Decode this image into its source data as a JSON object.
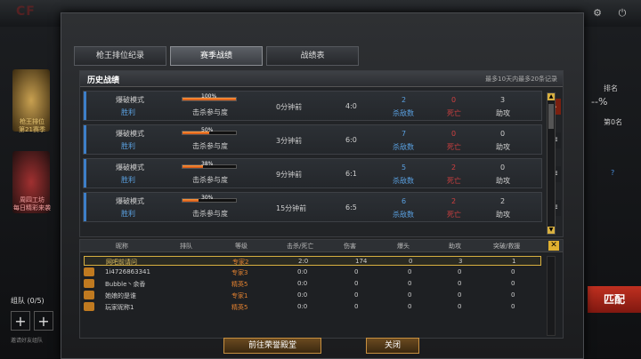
{
  "bg": {
    "left_rank": "枪王排位",
    "left_rank2": "第21赛季",
    "left_event": "周四工坊",
    "left_event2": "每日精彩来袭",
    "squad": "组队 (0/5)",
    "invite_hint": "邀请好友组队",
    "right_rank_label": "排名",
    "right_pct": "--%",
    "right_place": "第0名",
    "match_label": "匹配"
  },
  "tabs": [
    "枪王排位纪录",
    "赛季战绩",
    "战绩表"
  ],
  "panel": {
    "title": "历史战绩",
    "note": "最多10天内最多20条记录"
  },
  "history": [
    {
      "mode": "爆破模式",
      "result": "胜利",
      "pct": 100,
      "pct_text": "100%",
      "metric": "击杀参与度",
      "time": "0分钟前",
      "score": "4:0",
      "kills": "2",
      "kills_lbl": "杀敌数",
      "deaths": "0",
      "deaths_lbl": "死亡",
      "assists": "3",
      "assists_lbl": "助攻"
    },
    {
      "mode": "爆破模式",
      "result": "胜利",
      "pct": 50,
      "pct_text": "50%",
      "metric": "击杀参与度",
      "time": "3分钟前",
      "score": "6:0",
      "kills": "7",
      "kills_lbl": "杀敌数",
      "deaths": "0",
      "deaths_lbl": "死亡",
      "assists": "0",
      "assists_lbl": "助攻"
    },
    {
      "mode": "爆破模式",
      "result": "胜利",
      "pct": 38,
      "pct_text": "38%",
      "metric": "击杀参与度",
      "time": "9分钟前",
      "score": "6:1",
      "kills": "5",
      "kills_lbl": "杀敌数",
      "deaths": "2",
      "deaths_lbl": "死亡",
      "assists": "0",
      "assists_lbl": "助攻"
    },
    {
      "mode": "爆破模式",
      "result": "胜利",
      "pct": 30,
      "pct_text": "30%",
      "metric": "击杀参与度",
      "time": "15分钟前",
      "score": "6:5",
      "kills": "6",
      "kills_lbl": "杀敌数",
      "deaths": "2",
      "deaths_lbl": "死亡",
      "assists": "2",
      "assists_lbl": "助攻"
    }
  ],
  "table": {
    "headers": [
      "昵称",
      "排队",
      "等级",
      "击杀/死亡",
      "伤害",
      "爆头",
      "助攻",
      "突破/救援"
    ],
    "rows": [
      {
        "name": "网吧前请问",
        "rank": "",
        "level": "专家2",
        "kd": "2:0",
        "dmg": "174",
        "hs": "0",
        "ast": "3",
        "brk": "1",
        "me": true
      },
      {
        "name": "1i4726863341",
        "rank": "",
        "level": "专家3",
        "kd": "0:0",
        "dmg": "0",
        "hs": "0",
        "ast": "0",
        "brk": "0",
        "me": false
      },
      {
        "name": "Bubble丶余香",
        "rank": "",
        "level": "精英5",
        "kd": "0:0",
        "dmg": "0",
        "hs": "0",
        "ast": "0",
        "brk": "0",
        "me": false
      },
      {
        "name": "她娘的是谁",
        "rank": "",
        "level": "专家1",
        "kd": "0:0",
        "dmg": "0",
        "hs": "0",
        "ast": "0",
        "brk": "0",
        "me": false
      },
      {
        "name": "玩家昵称1",
        "rank": "",
        "level": "精英5",
        "kd": "0:0",
        "dmg": "0",
        "hs": "0",
        "ast": "0",
        "brk": "0",
        "me": false
      }
    ]
  },
  "buttons": {
    "hall": "前往荣誉殿堂",
    "close": "关闭"
  },
  "colors": {
    "accent": "#3d7fc9",
    "bar": "#ff9a40",
    "gold": "#d8b040"
  },
  "icons": {
    "expand": "chevron-down-icon",
    "menu": "menu-icon",
    "close": "close-icon"
  }
}
